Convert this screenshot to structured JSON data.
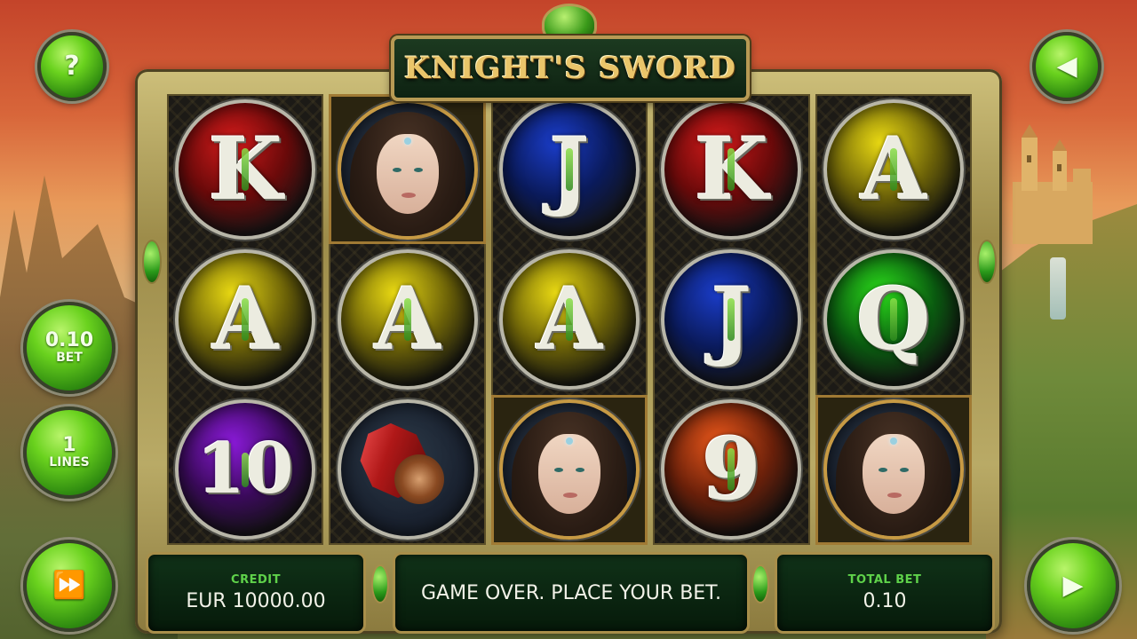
{
  "game": {
    "title": "KNIGHT'S SWORD"
  },
  "buttons": {
    "help_label": "?",
    "sound_icon": "speaker-icon",
    "bet_value": "0.10",
    "bet_label": "BET",
    "lines_value": "1",
    "lines_label": "LINES",
    "autoplay_icon": "fast-forward-icon",
    "spin_icon": "play-icon"
  },
  "reels": [
    [
      {
        "symbol": "K",
        "color": "red"
      },
      {
        "symbol": "A",
        "color": "yellow"
      },
      {
        "symbol": "10",
        "color": "purple"
      }
    ],
    [
      {
        "symbol": "lady",
        "color": "dark"
      },
      {
        "symbol": "A",
        "color": "yellow"
      },
      {
        "symbol": "ruby",
        "color": "dark"
      }
    ],
    [
      {
        "symbol": "J",
        "color": "blue"
      },
      {
        "symbol": "A",
        "color": "yellow"
      },
      {
        "symbol": "lady",
        "color": "dark"
      }
    ],
    [
      {
        "symbol": "K",
        "color": "red"
      },
      {
        "symbol": "J",
        "color": "blue"
      },
      {
        "symbol": "9",
        "color": "orange"
      }
    ],
    [
      {
        "symbol": "A",
        "color": "yellow"
      },
      {
        "symbol": "Q",
        "color": "green"
      },
      {
        "symbol": "lady",
        "color": "dark"
      }
    ]
  ],
  "status": {
    "credit_label": "CREDIT",
    "credit_value": "EUR 10000.00",
    "message": "GAME OVER. PLACE YOUR BET.",
    "total_bet_label": "TOTAL BET",
    "total_bet_value": "0.10"
  }
}
